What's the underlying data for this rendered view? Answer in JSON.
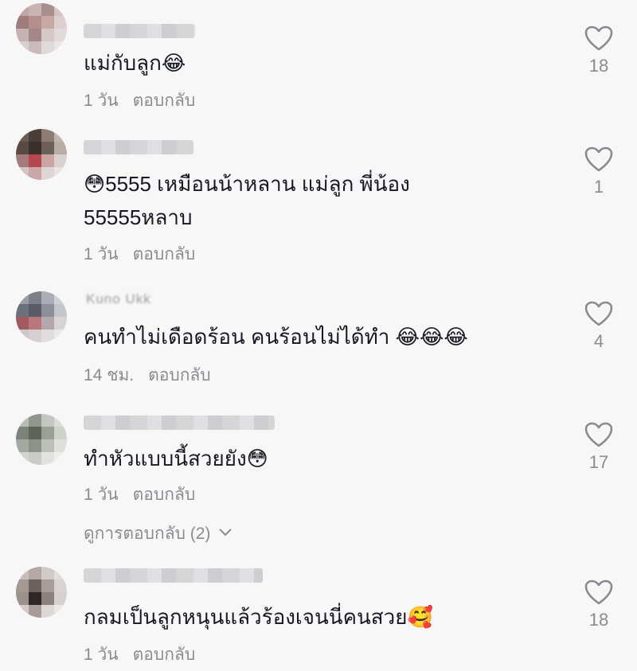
{
  "comments": [
    {
      "username": "",
      "text": "แม่กับลูก😂",
      "time": "1 วัน",
      "reply_label": "ตอบกลับ",
      "likes": "18"
    },
    {
      "username": "",
      "text": "😳5555 เหมือนน้าหลาน แม่ลูก พี่น้อง 55555หลาบ",
      "time": "1 วัน",
      "reply_label": "ตอบกลับ",
      "likes": "1"
    },
    {
      "username": "Kuno Ukk",
      "text": "คนทำไม่เดือดร้อน คนร้อนไม่ได้ทำ 😂😂😂",
      "time": "14 ชม.",
      "reply_label": "ตอบกลับ",
      "likes": "4"
    },
    {
      "username": "",
      "text": "ทำหัวแบบนี้สวยยัง😳",
      "time": "1 วัน",
      "reply_label": "ตอบกลับ",
      "likes": "17",
      "view_replies": "ดูการตอบกลับ (2)"
    },
    {
      "username": "",
      "text": "กลมเป็นลูกหนุนแล้วร้องเจนนี่คนสวย🥰",
      "time": "1 วัน",
      "reply_label": "ตอบกลับ",
      "likes": "18"
    }
  ],
  "icons": {
    "like": "heart-outline-icon",
    "expand": "chevron-down-icon"
  },
  "colors": {
    "background": "#f7f7f7",
    "text": "#161823",
    "secondary": "#8a8b91"
  }
}
